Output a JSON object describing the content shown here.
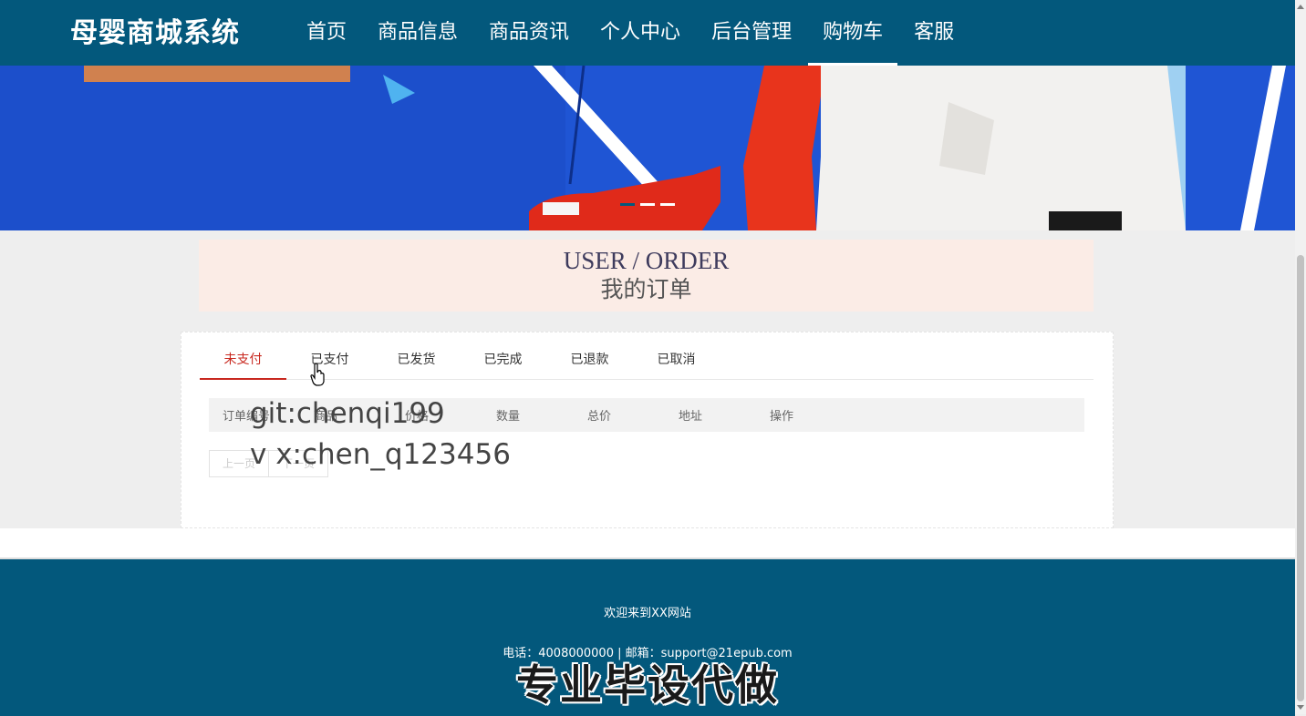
{
  "header": {
    "brand": "母婴商城系统",
    "nav": [
      {
        "label": "首页",
        "active": false
      },
      {
        "label": "商品信息",
        "active": false
      },
      {
        "label": "商品资讯",
        "active": false
      },
      {
        "label": "个人中心",
        "active": false
      },
      {
        "label": "后台管理",
        "active": false
      },
      {
        "label": "购物车",
        "active": true
      },
      {
        "label": "客服",
        "active": false
      }
    ]
  },
  "banner": {
    "slide_count": 3,
    "active_slide": 1
  },
  "section": {
    "title_en": "USER / ORDER",
    "title_cn": "我的订单"
  },
  "orders": {
    "tabs": [
      "未支付",
      "已支付",
      "已发货",
      "已完成",
      "已退款",
      "已取消"
    ],
    "active_tab": 0,
    "columns": [
      "订单编号",
      "商品",
      "价格",
      "数量",
      "总价",
      "地址",
      "操作"
    ],
    "pager": {
      "prev": "上一页",
      "next": "下一页"
    }
  },
  "watermark": {
    "line1": "git:chenqi199",
    "line2": "v x:chen_q123456"
  },
  "footer": {
    "welcome": "欢迎来到XX网站",
    "contact": "电话：4008000000 | 邮箱：support@21epub.com",
    "stamp": "专业毕设代做"
  },
  "colors": {
    "header_bg": "#03587c",
    "active_tab": "#c8281f",
    "title_band": "#fbece6"
  }
}
